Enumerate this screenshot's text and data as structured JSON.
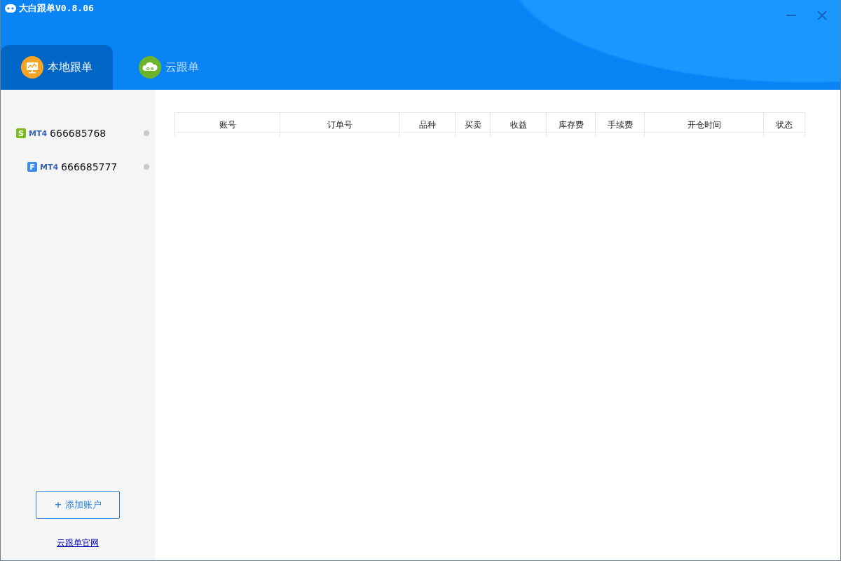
{
  "window": {
    "title": "大白跟单V0.8.06"
  },
  "tabs": [
    {
      "label": "本地跟单",
      "selected": true,
      "kind": "monitor"
    },
    {
      "label": "云跟单",
      "selected": false,
      "kind": "cloud"
    }
  ],
  "accounts": [
    {
      "badge": "S",
      "color": "#7cbb1c",
      "platform": "MT4",
      "number": "666685768",
      "children": [
        {
          "badge": "F",
          "color": "#3a8ef0",
          "platform": "MT4",
          "number": "666685777"
        }
      ]
    }
  ],
  "add_button": "添加账户",
  "add_icon": "+",
  "site_link": "云跟单官网",
  "table": {
    "columns": [
      "账号",
      "订单号",
      "品种",
      "买卖",
      "收益",
      "库存费",
      "手续费",
      "开仓时间",
      "状态"
    ]
  }
}
